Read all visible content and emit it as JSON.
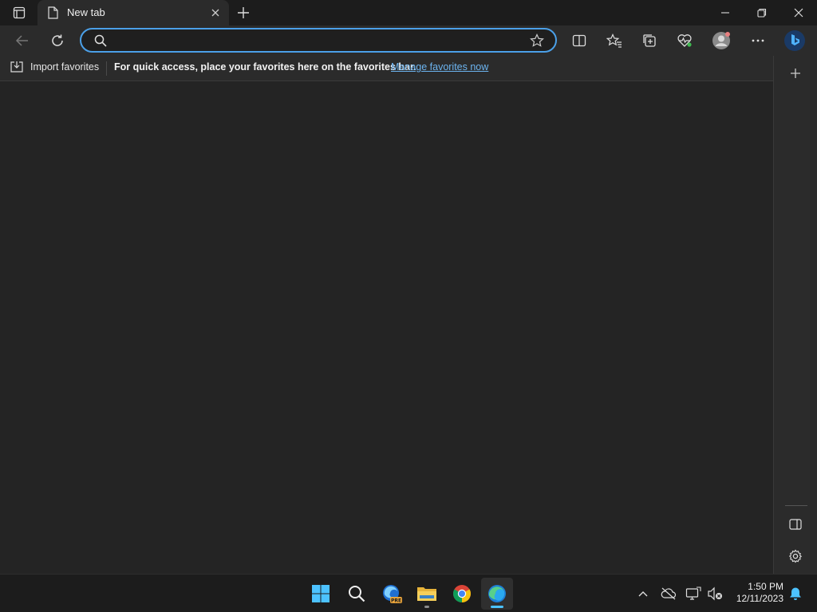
{
  "tab": {
    "title": "New tab"
  },
  "address": {
    "value": "",
    "placeholder": ""
  },
  "favorites_bar": {
    "import_label": "Import favorites",
    "message": "For quick access, place your favorites here on the favorites bar.",
    "manage_link": "Manage favorites now"
  },
  "taskbar": {
    "apps": [
      "start-icon",
      "search-icon",
      "edge-preview-icon",
      "file-explorer-icon",
      "chrome-icon",
      "edge-icon"
    ],
    "edge_preview_badge": "PRE"
  },
  "clock": {
    "time": "1:50 PM",
    "date": "12/11/2023"
  },
  "colors": {
    "accent": "#4ba0e8",
    "link": "#6cb4f0",
    "background": "#242424"
  }
}
